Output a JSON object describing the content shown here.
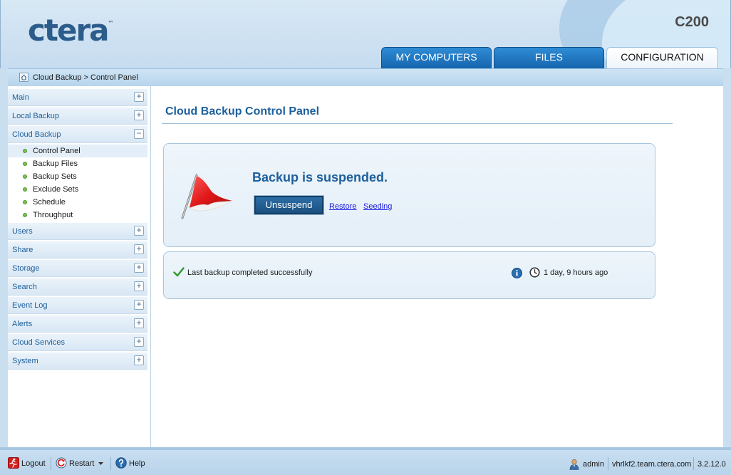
{
  "header": {
    "logo_text": "ctera",
    "logo_tm": "™",
    "model": "C200",
    "tabs": [
      {
        "label": "MY COMPUTERS",
        "active": false
      },
      {
        "label": "FILES",
        "active": false
      },
      {
        "label": "CONFIGURATION",
        "active": true
      }
    ]
  },
  "breadcrumb": {
    "icon": "home-icon",
    "text": "Cloud Backup > Control Panel"
  },
  "sidebar": {
    "sections": [
      {
        "label": "Main",
        "toggle": "+"
      },
      {
        "label": "Local Backup",
        "toggle": "+"
      },
      {
        "label": "Cloud Backup",
        "toggle": "−",
        "items": [
          {
            "label": "Control Panel",
            "active": true
          },
          {
            "label": "Backup Files"
          },
          {
            "label": "Backup Sets"
          },
          {
            "label": "Exclude Sets"
          },
          {
            "label": "Schedule"
          },
          {
            "label": "Throughput"
          }
        ]
      },
      {
        "label": "Users",
        "toggle": "+"
      },
      {
        "label": "Share",
        "toggle": "+"
      },
      {
        "label": "Storage",
        "toggle": "+"
      },
      {
        "label": "Search",
        "toggle": "+"
      },
      {
        "label": "Event Log",
        "toggle": "+"
      },
      {
        "label": "Alerts",
        "toggle": "+"
      },
      {
        "label": "Cloud Services",
        "toggle": "+"
      },
      {
        "label": "System",
        "toggle": "+"
      }
    ]
  },
  "main": {
    "title": "Cloud Backup Control Panel",
    "status": {
      "icon": "red-flag-icon",
      "heading": "Backup is suspended.",
      "unsuspend_label": "Unsuspend",
      "restore_label": "Restore",
      "seeding_label": "Seeding"
    },
    "info": {
      "icon": "checkmark-icon",
      "message": "Last backup completed successfully",
      "time": "1 day, 9 hours ago"
    }
  },
  "footer": {
    "logout_label": "Logout",
    "restart_label": "Restart",
    "help_label": "Help",
    "user": "admin",
    "host": "vhrlkf2.team.ctera.com",
    "version": "3.2.12.0"
  },
  "colors": {
    "accent": "#1d5f9c",
    "tab_blue": "#1b6cb3",
    "success_green": "#2e9a2a",
    "flag_red": "#d41d1d"
  }
}
